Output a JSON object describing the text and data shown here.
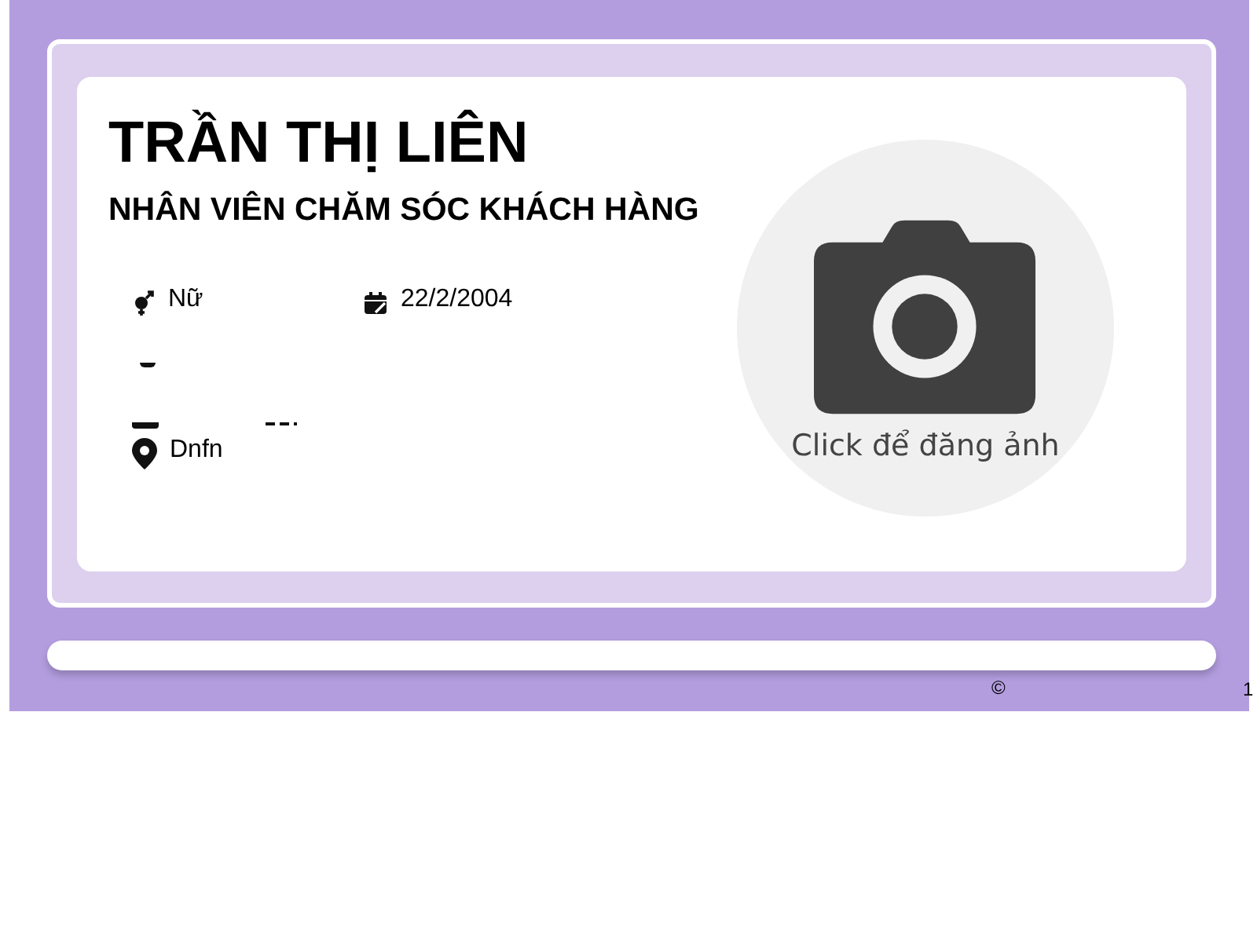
{
  "profile": {
    "name": "TRẦN THỊ LIÊN",
    "position": "NHÂN VIÊN CHĂM SÓC KHÁCH HÀNG",
    "details": [
      {
        "kind": "gender",
        "text": "Nữ"
      },
      {
        "kind": "birthday",
        "text": "22/2/2004"
      }
    ],
    "address": {
      "kind": "location",
      "text": "Dnfn"
    }
  },
  "photo": {
    "caption": "Click để đăng ảnh"
  },
  "footer": {
    "copyright": "©",
    "note": "1"
  }
}
